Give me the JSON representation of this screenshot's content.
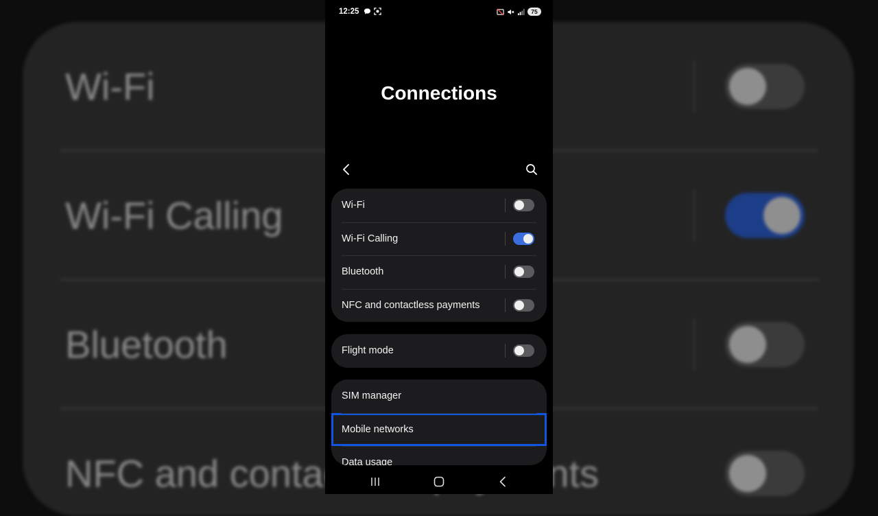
{
  "status_bar": {
    "time": "12:25",
    "battery": "75",
    "left_icons": [
      "chat-bubble-icon",
      "screen-record-icon"
    ],
    "right_icons": [
      "cast-off-icon",
      "mute-icon",
      "signal-icon"
    ]
  },
  "page": {
    "title": "Connections"
  },
  "toolbar": {
    "back_icon": "chevron-left-icon",
    "search_icon": "search-icon"
  },
  "groups": [
    {
      "items": [
        {
          "label": "Wi-Fi",
          "toggle": false
        },
        {
          "label": "Wi-Fi Calling",
          "toggle": true
        },
        {
          "label": "Bluetooth",
          "toggle": false
        },
        {
          "label": "NFC and contactless payments",
          "toggle": false
        }
      ]
    },
    {
      "items": [
        {
          "label": "Flight mode",
          "toggle": false
        }
      ]
    },
    {
      "items": [
        {
          "label": "SIM manager"
        },
        {
          "label": "Mobile networks",
          "focused": true
        },
        {
          "label": "Data usage"
        }
      ]
    }
  ],
  "background_preview": {
    "rows": [
      {
        "label": "Wi-Fi",
        "toggle": false
      },
      {
        "label": "Wi-Fi Calling",
        "toggle": true
      },
      {
        "label": "Bluetooth",
        "toggle": false
      },
      {
        "label": "NFC and contactless payments",
        "toggle": false
      }
    ]
  },
  "nav_bar": {
    "buttons": [
      "recent-apps-icon",
      "home-icon",
      "back-icon"
    ]
  },
  "colors": {
    "accent": "#3d6ee0",
    "focus_outline": "#0f55e0",
    "card_bg": "#1c1c1e",
    "screen_bg": "#000000"
  }
}
